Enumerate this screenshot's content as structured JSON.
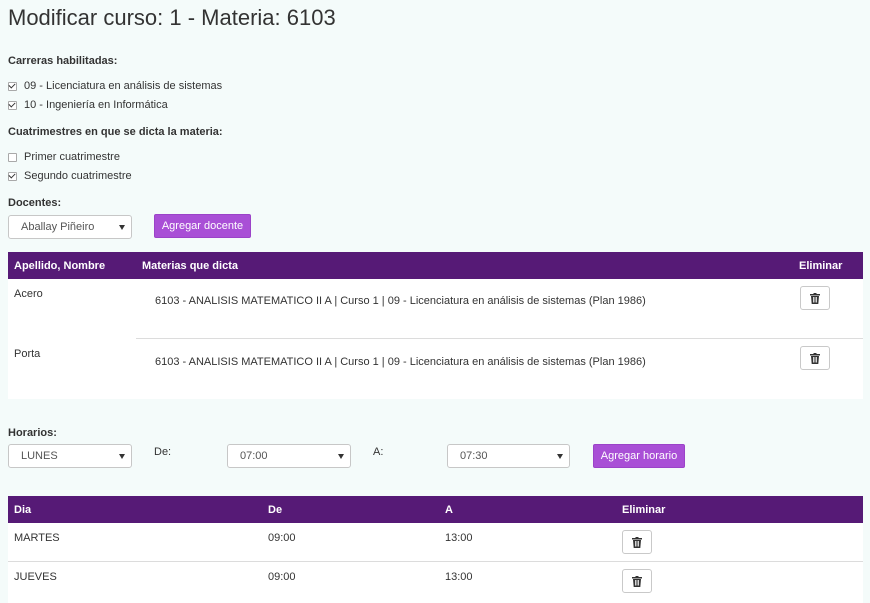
{
  "page": {
    "title": "Modificar curso: 1 - Materia: 6103"
  },
  "carreras": {
    "label": "Carreras habilitadas:",
    "items": [
      {
        "label": "09 - Licenciatura en análisis de sistemas",
        "checked": true
      },
      {
        "label": "10 - Ingeniería en Informática",
        "checked": true
      }
    ]
  },
  "cuatrimestres": {
    "label": "Cuatrimestres en que se dicta la materia:",
    "items": [
      {
        "label": "Primer cuatrimestre",
        "checked": false
      },
      {
        "label": "Segundo cuatrimestre",
        "checked": true
      }
    ]
  },
  "docentes": {
    "label": "Docentes:",
    "select_value": "Aballay Piñeiro",
    "add_button": "Agregar docente",
    "table": {
      "headers": [
        "Apellido, Nombre",
        "Materias que dicta",
        "Eliminar"
      ],
      "rows": [
        {
          "nombre": "Acero",
          "materias": "6103 - ANALISIS MATEMATICO II A | Curso 1 | 09 - Licenciatura en análisis de sistemas (Plan 1986)"
        },
        {
          "nombre": "Porta",
          "materias": "6103 - ANALISIS MATEMATICO II A | Curso 1 | 09 - Licenciatura en análisis de sistemas (Plan 1986)"
        }
      ]
    }
  },
  "horarios": {
    "label": "Horarios:",
    "dia_value": "LUNES",
    "de_label": "De:",
    "de_value": "07:00",
    "a_label": "A:",
    "a_value": "07:30",
    "add_button": "Agregar horario",
    "table": {
      "headers": [
        "Dia",
        "De",
        "A",
        "Eliminar"
      ],
      "rows": [
        {
          "dia": "MARTES",
          "de": "09:00",
          "a": "13:00"
        },
        {
          "dia": "JUEVES",
          "de": "09:00",
          "a": "13:00"
        }
      ]
    }
  },
  "colors": {
    "header_bg": "#561a76",
    "accent": "#a94fd6",
    "page_bg": "#f4fbfa"
  }
}
